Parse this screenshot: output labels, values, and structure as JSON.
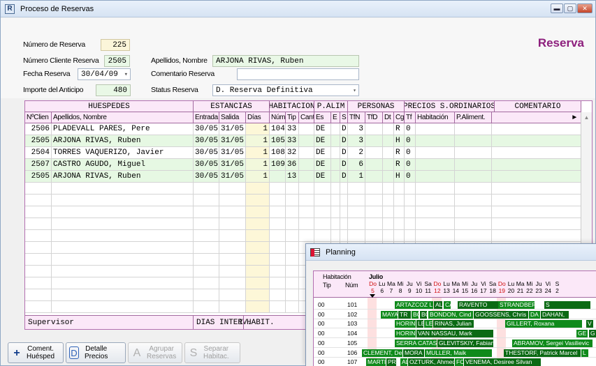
{
  "window": {
    "title": "Proceso de Reservas",
    "app_icon": "R"
  },
  "form": {
    "numero_reserva_label": "Número de Reserva",
    "numero_reserva": "225",
    "numero_cliente_label": "Número Cliente Reserva",
    "numero_cliente": "2505",
    "apellidos_label": "Apellidos, Nombre",
    "apellidos": "ARJONA RIVAS, Ruben",
    "fecha_label": "Fecha Reserva",
    "fecha": "30/04/09",
    "comentario_label": "Comentario Reserva",
    "comentario": "",
    "importe_label": "Importe del Anticipo",
    "importe": "480",
    "status_label": "Status Reserva",
    "status": "D. Reserva Definitiva",
    "heading": "Reserva"
  },
  "grid": {
    "groups": [
      "HUESPEDES",
      "ESTANCIAS",
      "HABITACION",
      "P.ALIM",
      "PERSONAS",
      "PRECIOS S.ORDINARIOS",
      "COMENTARIO"
    ],
    "headers": [
      "NºClien",
      "Apellidos, Nombre",
      "Entrada",
      "Salida",
      "Días",
      "Núm.",
      "Tip",
      "Cant",
      "Es",
      "E",
      "S",
      "TfN",
      "TfD",
      "Dt",
      "Cg",
      "Tf",
      "Habitación",
      "P.Aliment.",
      "►"
    ],
    "rows": [
      [
        "2506",
        "PLADEVALL PARES, Pere",
        "30/05",
        "31/05",
        "1",
        "104",
        "33",
        "",
        "DE",
        "",
        "D",
        "3",
        "",
        "",
        "R",
        "0",
        "",
        ""
      ],
      [
        "2505",
        "ARJONA RIVAS, Ruben",
        "30/05",
        "31/05",
        "1",
        "105",
        "33",
        "",
        "DE",
        "",
        "D",
        "3",
        "",
        "",
        "H",
        "0",
        "",
        ""
      ],
      [
        "2504",
        "TORRES VAQUERIZO, Javier",
        "30/05",
        "31/05",
        "1",
        "108",
        "32",
        "",
        "DE",
        "",
        "D",
        "2",
        "",
        "",
        "R",
        "0",
        "",
        ""
      ],
      [
        "2507",
        "CASTRO AGUDO, Miguel",
        "30/05",
        "31/05",
        "1",
        "109",
        "36",
        "",
        "DE",
        "",
        "D",
        "6",
        "",
        "",
        "R",
        "0",
        "",
        ""
      ],
      [
        "2505",
        "ARJONA RIVAS, Ruben",
        "30/05",
        "31/05",
        "1",
        "",
        "13",
        "",
        "DE",
        "",
        "D",
        "1",
        "",
        "",
        "H",
        "0",
        "",
        ""
      ]
    ],
    "footer": {
      "user": "Supervisor",
      "dias_label": "DIAS INTERV.",
      "dias_value": "1",
      "habit_label": "HABIT."
    }
  },
  "buttons": [
    {
      "icon": "+",
      "label": "Coment.\nHuésped",
      "enabled": true
    },
    {
      "icon": "D",
      "label": "Detalle\nPrecios",
      "enabled": true
    },
    {
      "icon": "A",
      "label": "Agrupar\nReservas",
      "enabled": false
    },
    {
      "icon": "S",
      "label": "Separar\nHabitac.",
      "enabled": false
    }
  ],
  "planning": {
    "title": "Planning",
    "col_habitacion": "Habitación",
    "col_tip": "Tip",
    "col_num": "Núm",
    "month": "Julio",
    "weekdays": [
      "Do",
      "Lu",
      "Ma",
      "Mi",
      "Ju",
      "Vi",
      "Sa",
      "Do",
      "Lu",
      "Ma",
      "Mi",
      "Ju",
      "Vi",
      "Sa",
      "Do",
      "Lu",
      "Ma",
      "Mi",
      "Ju",
      "Vi",
      "S"
    ],
    "days": [
      "5",
      "6",
      "7",
      "8",
      "9",
      "10",
      "11",
      "12",
      "13",
      "14",
      "15",
      "16",
      "17",
      "18",
      "19",
      "20",
      "21",
      "22",
      "23",
      "24",
      "2"
    ],
    "rooms": [
      {
        "tip": "00",
        "num": "101",
        "bars": [
          "ARTAZCOZ L",
          "AL",
          "CAMARON",
          "RAVENTO",
          "STRANDBERG",
          "S"
        ]
      },
      {
        "tip": "00",
        "num": "102",
        "bars": [
          "MAYA",
          "TR",
          "BC",
          "BC",
          "BONDON, Cind",
          "GOOSSENS, Chris Fra",
          "DA",
          "DAHAN,"
        ]
      },
      {
        "tip": "00",
        "num": "103",
        "bars": [
          "HORIN",
          "LE",
          "LE",
          "RINAS, Julian",
          "GILLERT, Roxana",
          "V"
        ]
      },
      {
        "tip": "00",
        "num": "104",
        "bars": [
          "HORIN",
          "VAN NASSAU, Mark",
          "GE",
          "G"
        ]
      },
      {
        "tip": "00",
        "num": "105",
        "bars": [
          "SERRA CATAS",
          "GLEVITSKIY, Fabian",
          "ABRAMOV, Sergei Vasilievic"
        ]
      },
      {
        "tip": "00",
        "num": "106",
        "bars": [
          "CLEMENT, Deb",
          "MORA",
          "MULLER, Maik",
          "THESTORF, Patrick Marcel",
          "L"
        ]
      },
      {
        "tip": "00",
        "num": "107",
        "bars": [
          "MARTIN O",
          "PR",
          "AL",
          "OZTURK, Ahmed Rashim",
          "FC",
          "VENEMA, Desiree Silvan"
        ]
      }
    ]
  },
  "colors": {
    "accent": "#8d1f7d",
    "header_bg": "#fbe8f8",
    "row_alt": "#e6f8e3",
    "planning_bar": "#0f8a1b"
  }
}
